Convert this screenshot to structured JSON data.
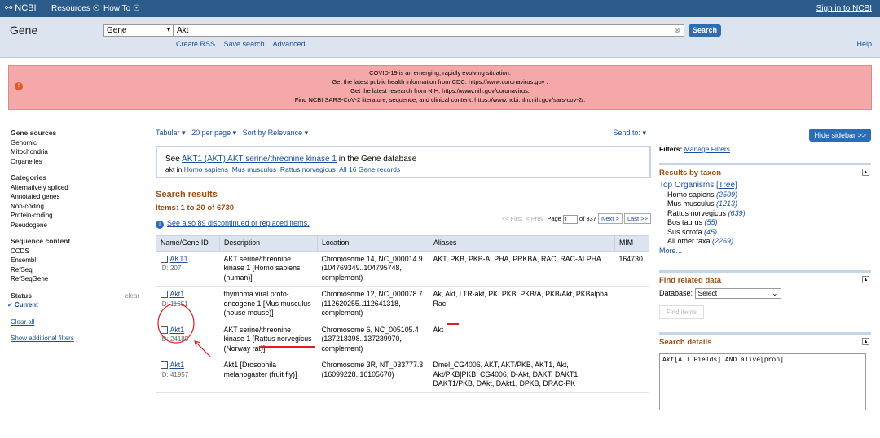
{
  "topbar": {
    "logo": "NCBI",
    "resources": "Resources ☉",
    "howto": "How To ☉",
    "signin": "Sign in to NCBI"
  },
  "header": {
    "db": "Gene",
    "select_value": "Gene",
    "query": "Akt",
    "search_btn": "Search",
    "links": [
      "Create RSS",
      "Save search",
      "Advanced"
    ],
    "help": "Help"
  },
  "covid": [
    "COVID-19 is an emerging, rapidly evolving situation.",
    "Get the latest public health information from CDC: https://www.coronavirus.gov .",
    "Get the latest research from NIH: https://www.nih.gov/coronavirus.",
    "Find NCBI SARS-CoV-2 literature, sequence, and clinical content: https://www.ncbi.nlm.nih.gov/sars-cov-2/."
  ],
  "sidebar": {
    "gene_sources": {
      "title": "Gene sources",
      "items": [
        "Genomic",
        "Mitochondria",
        "Organelles"
      ]
    },
    "categories": {
      "title": "Categories",
      "items": [
        "Alternatively spliced",
        "Annotated genes",
        "Non-coding",
        "Protein-coding",
        "Pseudogene"
      ]
    },
    "seq": {
      "title": "Sequence content",
      "items": [
        "CCDS",
        "Ensembl",
        "RefSeq",
        "RefSeqGene"
      ]
    },
    "status": {
      "title": "Status",
      "clear": "clear",
      "current": "✓ Current"
    },
    "clear_all": "Clear all",
    "show_filters": "Show additional filters"
  },
  "toolbar": {
    "format": "Tabular ▾",
    "per_page": "20 per page ▾",
    "sort": "Sort by Relevance ▾",
    "send_to": "Send to: ▾"
  },
  "see_box": {
    "see": "See",
    "link": "AKT1 (AKT) AKT serine/threonine kinase 1",
    "rest": "in the Gene database",
    "akt_in": "akt in",
    "orgs": [
      "Homo sapiens",
      "Mus musculus",
      "Rattus norvegicus",
      "All 16 Gene records"
    ]
  },
  "results": {
    "title": "Search results",
    "items": "Items: 1 to 20 of 6730",
    "first": "<< First",
    "prev": "< Prev",
    "page_label": "Page",
    "page": "1",
    "of": "of 337",
    "next": "Next >",
    "last": "Last >>",
    "see_also": "See also 89 discontinued or replaced items."
  },
  "table": {
    "headers": [
      "Name/Gene ID",
      "Description",
      "Location",
      "Aliases",
      "MIM"
    ],
    "rows": [
      {
        "name": "AKT1",
        "id": "ID: 207",
        "desc": "AKT serine/threonine kinase 1 [Homo sapiens (human)]",
        "loc": "Chromosome 14, NC_000014.9 (104769349..104795748, complement)",
        "alias": "AKT, PKB, PKB-ALPHA, PRKBA, RAC, RAC-ALPHA",
        "mim": "164730"
      },
      {
        "name": "Akt1",
        "id": "ID: 11651",
        "desc": "thymoma viral proto-oncogene 1 [Mus musculus (house mouse)]",
        "loc": "Chromosome 12, NC_000078.7 (112620255..112641318, complement)",
        "alias": "Ak, Akt, LTR-akt, PK, PKB, PKB/A, PKB/Akt, PKBalpha, Rac",
        "mim": ""
      },
      {
        "name": "Akt1",
        "id": "ID: 24185",
        "desc": "AKT serine/threonine kinase 1 [Rattus norvegicus (Norway rat)]",
        "loc": "Chromosome 6, NC_005105.4 (137218398..137239970, complement)",
        "alias": "Akt",
        "mim": ""
      },
      {
        "name": "Akt1",
        "id": "ID: 41957",
        "desc": "Akt1 [Drosophila melanogaster (fruit fly)]",
        "loc": "Chromosome 3R, NT_033777.3 (16099228..16105670)",
        "alias": "Dmel_CG4006, AKT, AKT/PKB, AKT1, Akt, Akt/PKB|PKB, CG4006, D-Akt, DAKT, DAKT1, DAKT1/PKB, DAkt, DAkt1, DPKB, DRAC-PK",
        "mim": ""
      }
    ]
  },
  "right": {
    "hide": "Hide sidebar >>",
    "filters": "Filters:",
    "manage": "Manage Filters",
    "taxon_title": "Results by taxon",
    "top_org": "Top Organisms",
    "tree": "[Tree]",
    "taxa": [
      {
        "n": "Homo sapiens",
        "c": "(2509)"
      },
      {
        "n": "Mus musculus",
        "c": "(1213)"
      },
      {
        "n": "Rattus norvegicus",
        "c": "(639)"
      },
      {
        "n": "Bos taurus",
        "c": "(55)"
      },
      {
        "n": "Sus scrofa",
        "c": "(45)"
      },
      {
        "n": "All other taxa",
        "c": "(2269)"
      }
    ],
    "more": "More...",
    "related_title": "Find related data",
    "database": "Database:",
    "db_select": "Select",
    "find_items": "Find items",
    "details_title": "Search details",
    "details": "Akt[All Fields] AND alive[prop]"
  }
}
